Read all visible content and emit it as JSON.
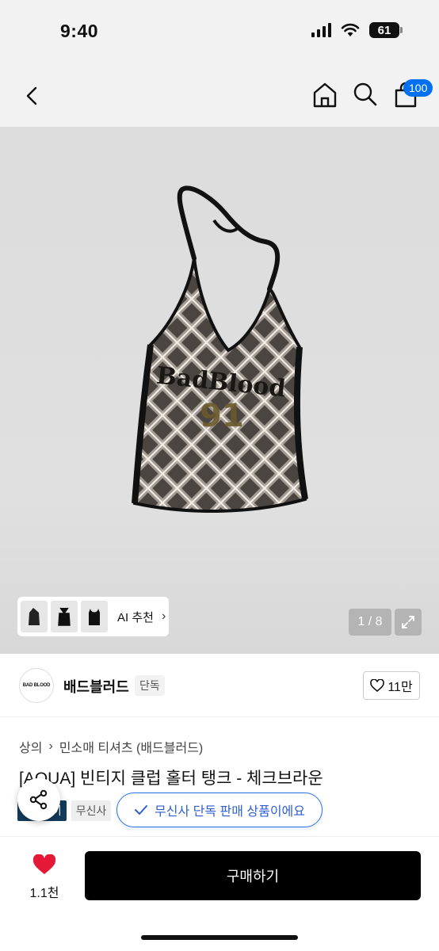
{
  "status": {
    "time": "9:40",
    "battery": "61"
  },
  "nav": {
    "back_icon": "chevron-left-icon",
    "home_icon": "home-icon",
    "search_icon": "search-icon",
    "cart_icon": "shopping-bag-icon",
    "cart_badge": "100"
  },
  "gallery": {
    "ai_label": "AI 추천",
    "page_counter": "1 / 8",
    "expand_icon": "expand-icon",
    "print_text": "BadBlood",
    "print_number": "91"
  },
  "brand": {
    "logo_text": "BAD BLOOD",
    "name": "배드블러드",
    "tag": "단독",
    "likes": "11만"
  },
  "breadcrumb": {
    "level1": "상의",
    "level2": "민소매 티셔츠 (배드블러드)"
  },
  "product": {
    "title": "[AQUA] 빈티지 클럽 홀터 탱크 - 체크브라운",
    "tag_pay": "페이",
    "tag_store": "무신사"
  },
  "toast": {
    "text": "무신사 단독 판매 상품이에요"
  },
  "bottom": {
    "wish_count": "1.1천",
    "buy_label": "구매하기"
  },
  "colors": {
    "accent_blue": "#2f6fe5",
    "badge_blue": "#0070f3",
    "heart_red": "#e51937",
    "buy_black": "#000000"
  }
}
